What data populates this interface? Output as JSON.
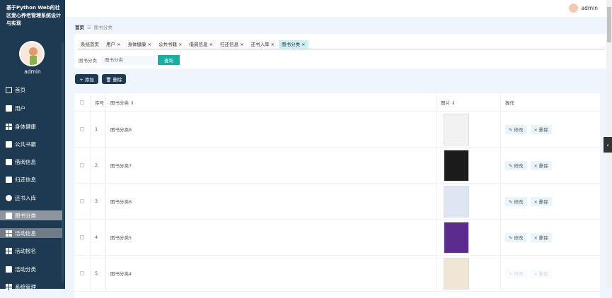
{
  "app": {
    "title": "基于Python Web的社区爱心养老管理系统设计与实现",
    "user": "admin"
  },
  "sidebar": {
    "items": [
      {
        "label": "首页",
        "icon": "home-icon"
      },
      {
        "label": "用户",
        "icon": "send-icon"
      },
      {
        "label": "身体健康",
        "icon": "grid-icon"
      },
      {
        "label": "公共书籍",
        "icon": "sliders-icon"
      },
      {
        "label": "借阅信息",
        "icon": "clipboard-icon"
      },
      {
        "label": "归还信息",
        "icon": "message-icon"
      },
      {
        "label": "还书入库",
        "icon": "location-icon"
      },
      {
        "label": "图书分类",
        "icon": "flag-icon"
      },
      {
        "label": "活动信息",
        "icon": "grid-icon"
      },
      {
        "label": "活动报名",
        "icon": "grid-icon"
      },
      {
        "label": "活动分类",
        "icon": "book-icon"
      },
      {
        "label": "系统管理",
        "icon": "grid-icon"
      }
    ]
  },
  "breadcrumb": {
    "home": "首页",
    "sep": "☰",
    "current": "图书分类"
  },
  "tabs": [
    "系统首页",
    "用户 ×",
    "身体健康 ×",
    "公共书籍 ×",
    "借阅信息 ×",
    "归还信息 ×",
    "还书入库 ×",
    "图书分类 ×"
  ],
  "search": {
    "label": "图书分类",
    "placeholder": "图书分类",
    "button": "查询"
  },
  "toolbar": {
    "add": "+ 添加",
    "delete": "🗑 删除"
  },
  "table": {
    "headers": [
      "",
      "序号",
      "图书分类 ⇕",
      "图片 ⇕",
      "操作"
    ],
    "edit_label": "✎ 修改",
    "delete_label": "× 删除",
    "rows": [
      {
        "no": "1",
        "name": "图书分类8",
        "cover": "#f2f2f2"
      },
      {
        "no": "2",
        "name": "图书分类7",
        "cover": "#1b1b1b"
      },
      {
        "no": "3",
        "name": "图书分类6",
        "cover": "#dfe5f2"
      },
      {
        "no": "4",
        "name": "图书分类5",
        "cover": "#5a2d8c"
      },
      {
        "no": "5",
        "name": "图书分类4",
        "cover": "#efe6d6"
      }
    ]
  }
}
